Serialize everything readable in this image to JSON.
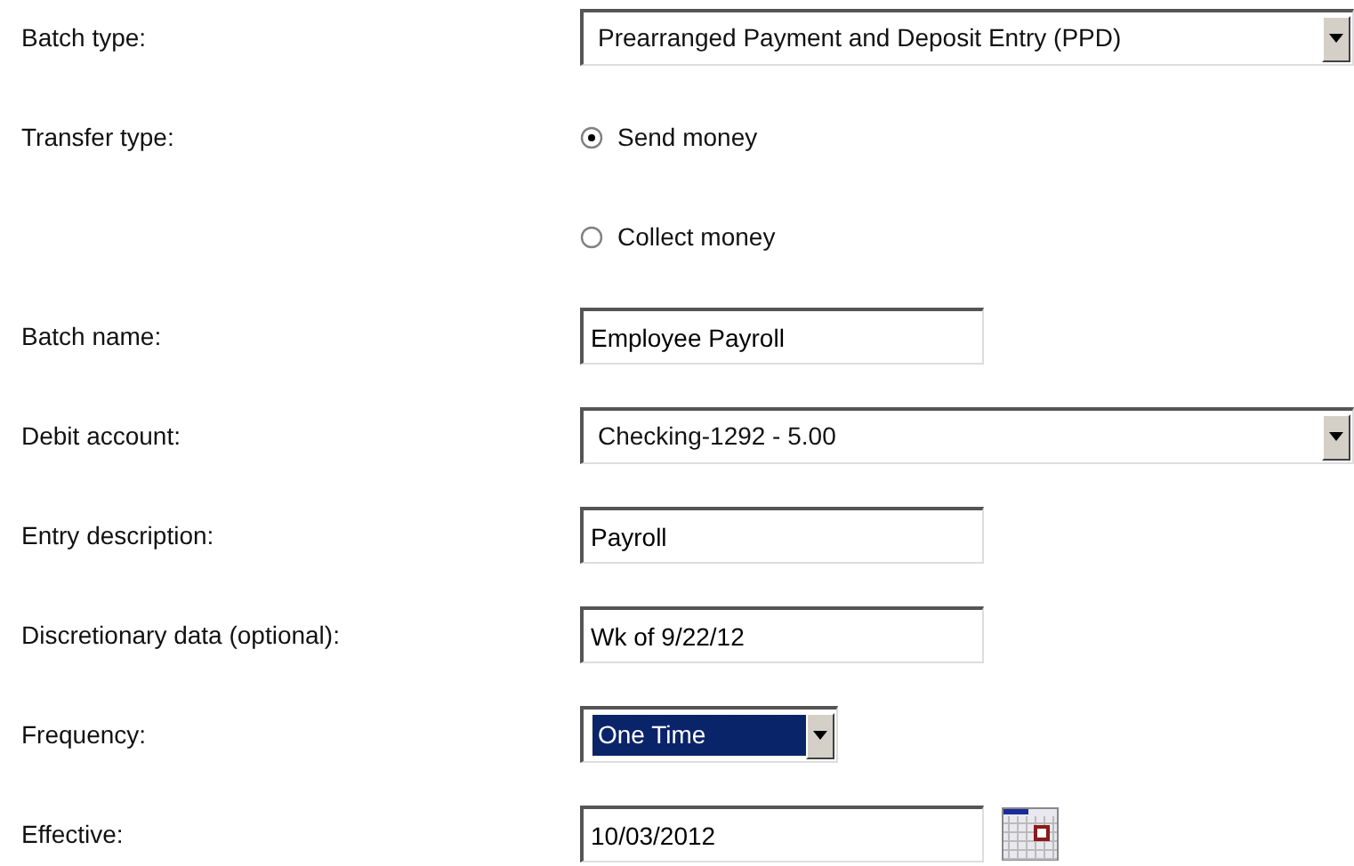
{
  "fields": [
    {
      "kind": "select",
      "label": "Batch type:",
      "value": "Prearranged Payment and Deposit Entry (PPD)",
      "focused": false
    },
    {
      "kind": "radio",
      "label": "Transfer type:",
      "options": [
        {
          "label": "Send money",
          "selected": true
        },
        {
          "label": "Collect money",
          "selected": false
        }
      ]
    },
    {
      "kind": "text",
      "label": "Batch name:",
      "value": "Employee Payroll"
    },
    {
      "kind": "select",
      "label": "Debit account:",
      "value": "Checking-1292 - 5.00",
      "focused": false
    },
    {
      "kind": "text",
      "label": "Entry description:",
      "value": "Payroll"
    },
    {
      "kind": "text",
      "label": "Discretionary data (optional):",
      "value": "Wk of 9/22/12"
    },
    {
      "kind": "select",
      "label": "Frequency:",
      "value": "One Time",
      "focused": true
    },
    {
      "kind": "date",
      "label": "Effective:",
      "value": "10/03/2012"
    }
  ]
}
